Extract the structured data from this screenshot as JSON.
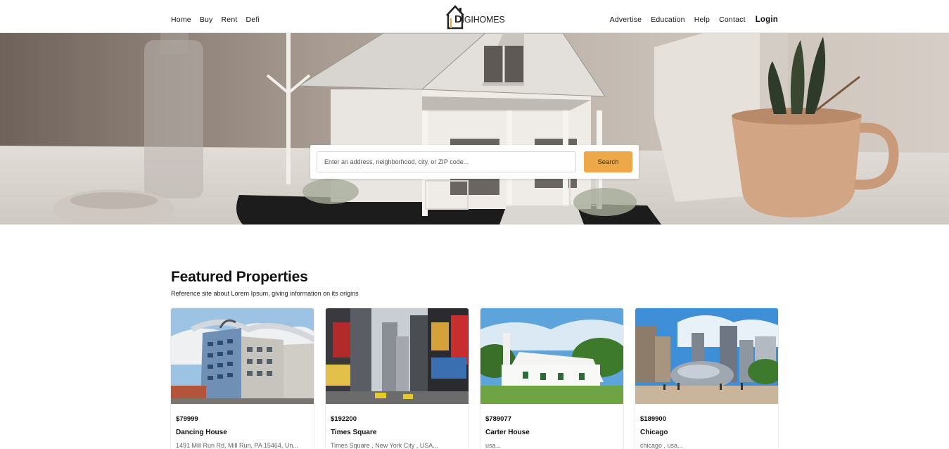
{
  "nav": {
    "left": [
      "Home",
      "Buy",
      "Rent",
      "Defi"
    ],
    "right": [
      "Advertise",
      "Education",
      "Help",
      "Contact"
    ],
    "login": "Login",
    "logo_first": "D",
    "logo_rest": "IGIHOMES"
  },
  "search": {
    "placeholder": "Enter an address, neighborhood, city, or ZIP code...",
    "button": "Search"
  },
  "featured": {
    "title": "Featured Properties",
    "subtitle": "Reference site about Lorem Ipsum, giving information on its origins",
    "cards": [
      {
        "price": "$79999",
        "name": "Dancing House",
        "address": "1491 Mill Run Rd, Mill Run, PA 15464, Un..."
      },
      {
        "price": "$192200",
        "name": "Times Square",
        "address": "Times Square , New York City , USA..."
      },
      {
        "price": "$789077",
        "name": "Carter House",
        "address": "usa..."
      },
      {
        "price": "$189900",
        "name": "Chicago",
        "address": "chicago , usa..."
      }
    ]
  },
  "colors": {
    "accent": "#eda84a",
    "text": "#111111",
    "muted": "#666666"
  }
}
